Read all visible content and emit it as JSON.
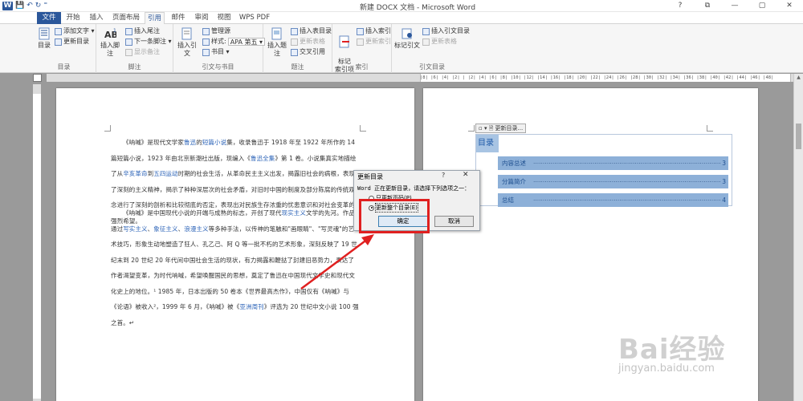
{
  "window": {
    "title": "新建 DOCX 文档 - Microsoft Word",
    "controls": [
      "?",
      "⧉",
      "—",
      "▢",
      "✕"
    ]
  },
  "qat": {
    "logo": "W",
    "save": "💾",
    "undo": "↶",
    "redo": "↻",
    "more": "⁼"
  },
  "tabs": [
    "文件",
    "开始",
    "插入",
    "页面布局",
    "引用",
    "邮件",
    "审阅",
    "视图",
    "WPS PDF"
  ],
  "active_tab": "引用",
  "ribbon": {
    "groups": {
      "toc": "目录",
      "footnotes": "脚注",
      "citations": "引文与书目",
      "captions": "题注",
      "index": "索引",
      "authorities": "引文目录"
    },
    "toc_btn": "目录",
    "add_text": "添加文字 ▾",
    "update_toc": "更新目录",
    "insert_footnote": "插入脚注",
    "insert_endnote": "插入尾注",
    "next_footnote": "下一条脚注 ▾",
    "show_notes": "显示备注",
    "insert_citation": "插入引文",
    "manage_sources": "管理源",
    "style_label": "样式:",
    "style_value": "APA 第五 ▾",
    "bibliography": "书目 ▾",
    "insert_caption": "插入题注",
    "insert_table_of_figures": "插入表目录",
    "update_table": "更新表格",
    "cross_reference": "交叉引用",
    "mark_entry": "标记\n索引项",
    "insert_index": "插入索引",
    "update_index": "更新索引",
    "mark_citation": "标记引文",
    "insert_toa": "插入引文目录",
    "update_toa": "更新表格"
  },
  "ruler_text": "|8| |6| |4| |2| |  |2| |4| |6| |8| |10| |12| |14| |16| |18| |20| |22| |24| |26| |28| |30| |32| |34| |36| |38| |40| |42| |44| |46| |48|",
  "document": {
    "paragraph1": [
      {
        "t": "《呐喊》是现代文学家"
      },
      {
        "t": "鲁迅",
        "link": true
      },
      {
        "t": "的"
      },
      {
        "t": "短篇小说",
        "link": true
      },
      {
        "t": "集，收录鲁迅于 1918 年至 1922 年所作的 14 篇短篇小说，1923 年由北京新潮社出版，现编入《"
      },
      {
        "t": "鲁迅全集",
        "link": true
      },
      {
        "t": "》第 1 卷。小说集真实地描绘了从"
      },
      {
        "t": "辛亥革命",
        "link": true
      },
      {
        "t": "到"
      },
      {
        "t": "五四运动",
        "link": true
      },
      {
        "t": "时期的社会生活，从革命民主主义出发，揭露旧社会的病根，表现了深刻的主义精神，揭示了种种深层次的社会矛盾，对旧时中国的制度及部分陈腐的传统观念进行了深刻的剖析和比较彻底的否定，表现出对民族生存浓重的忧患意识和对社会变革的强烈希望。"
      }
    ],
    "paragraph2": [
      {
        "t": "《呐喊》是中国现代小说的开端与成熟的标志，开创了现代"
      },
      {
        "t": "现实主义",
        "link": true
      },
      {
        "t": "文学的先河。作品通过"
      },
      {
        "t": "写实主义",
        "link": true
      },
      {
        "t": "、"
      },
      {
        "t": "象征主义",
        "link": true
      },
      {
        "t": "、"
      },
      {
        "t": "浪漫主义",
        "link": true
      },
      {
        "t": "等多种手法，以传神的笔触和\"画眼睛\"、\"写灵魂\"的艺术技巧，形象生动地塑造了狂人、孔乙己、阿 Q 等一批不朽的艺术形象，深刻反映了 19 世纪末到 20 世纪 20 年代间中国社会生活的现状，有力揭露和鞭挞了封建旧恶势力，表达了作者渴望变革，为时代呐喊，希望唤醒国民的思想，奠定了鲁迅在中国现代文学史和现代文化史上的地位。¹ 1985 年，日本出版的 50 卷本《世界最高杰作》，中国仅有《呐喊》与《论语》被收入²，1999 年 6 月，《呐喊》被《"
      },
      {
        "t": "亚洲周刊",
        "link": true
      },
      {
        "t": "》评选为 20 世纪中文小说 100 强之首。↵"
      }
    ]
  },
  "toc": {
    "control_label": "▫ ▾  🗎 更新目录...",
    "title": "目录",
    "entries": [
      {
        "label": "内容总述",
        "page": "3"
      },
      {
        "label": "分篇简介",
        "page": "3"
      },
      {
        "label": "总结",
        "page": "4"
      }
    ]
  },
  "dialog": {
    "title": "更新目录",
    "help": "?",
    "close": "✕",
    "message": "Word 正在更新目录，请选择下列选项之一：",
    "options": [
      {
        "label": "只更新页码(P)",
        "selected": false
      },
      {
        "label": "更新整个目录(E)",
        "selected": true
      }
    ],
    "ok": "确定",
    "cancel": "取消"
  },
  "watermark": {
    "brand": "Bai经验",
    "url": "jingyan.baidu.com"
  },
  "colors": {
    "accent": "#2b579a",
    "highlight": "#e02020",
    "toc_fill": "#8db0d8"
  }
}
